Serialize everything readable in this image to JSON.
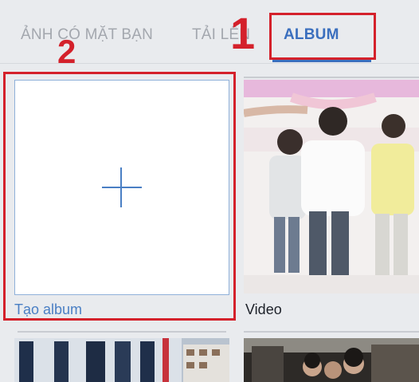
{
  "tabs": [
    {
      "label": "ẢNH CÓ MẶT BẠN",
      "active": false
    },
    {
      "label": "TẢI LÊN",
      "active": false
    },
    {
      "label": "ALBUM",
      "active": true
    }
  ],
  "create_album": {
    "label": "Tạo album",
    "icon": "plus-icon"
  },
  "albums": [
    {
      "label": "Video"
    }
  ],
  "annotations": [
    "1",
    "2"
  ],
  "colors": {
    "accent": "#3b6fbe",
    "annotation": "#d4212b",
    "background": "#e9ebee"
  }
}
